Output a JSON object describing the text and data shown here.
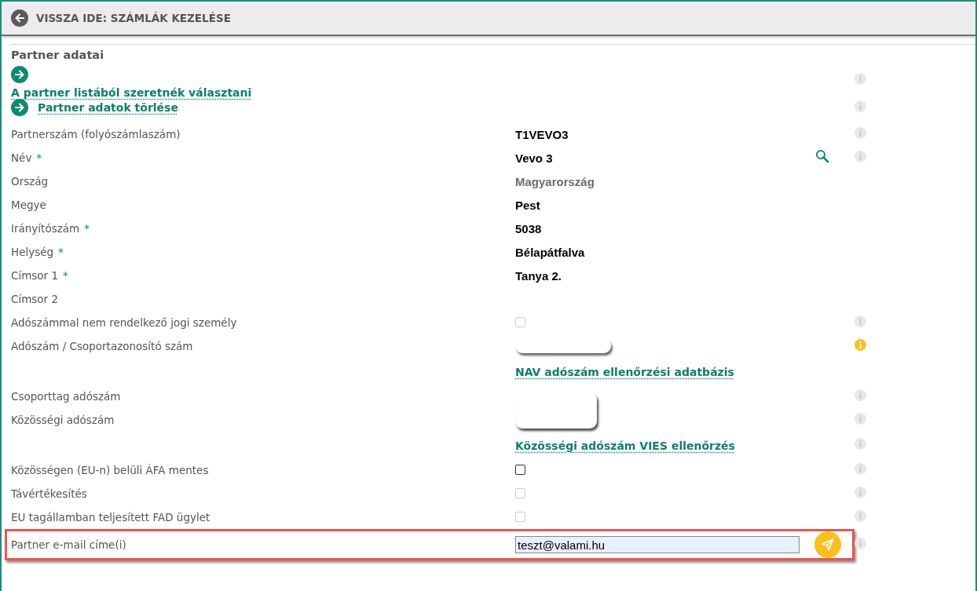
{
  "header": {
    "title": "VISSZA IDE: SZÁMLÁK KEZELÉSE"
  },
  "section": {
    "title": "Partner adatai"
  },
  "actions": [
    {
      "label": "A partner listából szeretnék választani",
      "stacked": true,
      "info": true
    },
    {
      "label": "Partner adatok törlése",
      "stacked": false,
      "info": true
    }
  ],
  "rows": [
    {
      "kind": "text",
      "label": "Partnerszám (folyószámlaszám)",
      "value": "T1VEVO3",
      "info": true
    },
    {
      "kind": "text",
      "label": "Név",
      "required_mark": "*",
      "value": "Vevo 3",
      "search": true,
      "info": true
    },
    {
      "kind": "muted",
      "label": "Ország",
      "value": "Magyarország"
    },
    {
      "kind": "text",
      "label": "Megye",
      "value": "Pest"
    },
    {
      "kind": "text",
      "label": "Irányítószám",
      "required_mark": "*",
      "value": "5038"
    },
    {
      "kind": "text",
      "label": "Helység",
      "required_mark": "*",
      "value": "Bélapátfalva"
    },
    {
      "kind": "text",
      "label": "Címsor 1",
      "required_mark": "*",
      "value": "Tanya 2."
    },
    {
      "kind": "text",
      "label": "Címsor 2"
    },
    {
      "kind": "checkbox",
      "label": "Adószámmal nem rendelkező jogi személy",
      "checked": false,
      "disabled": true,
      "info": true
    },
    {
      "kind": "pill",
      "label": "Adószám / Csoportazonosító szám",
      "warning": true
    },
    {
      "kind": "link",
      "link": "NAV adószám ellenőrzési adatbázis"
    },
    {
      "kind": "block",
      "label": "Csoporttag adószám",
      "info": true
    },
    {
      "kind": "text",
      "label": "Közösségi adószám",
      "info": true
    },
    {
      "kind": "link",
      "link": "Közösségi adószám VIES ellenőrzés",
      "info": true
    },
    {
      "kind": "checkbox",
      "label": "Közösségen (EU-n) belüli ÁFA mentes",
      "checked": false,
      "disabled": false,
      "info": true
    },
    {
      "kind": "checkbox",
      "label": "Távértékesítés",
      "checked": false,
      "disabled": true,
      "info": true
    },
    {
      "kind": "checkbox",
      "label": "EU tagállamban teljesített FAD ügylet",
      "checked": false,
      "disabled": true,
      "info": true
    },
    {
      "kind": "email",
      "label": "Partner e-mail címe(i)",
      "value": "teszt@valami.hu",
      "highlighted": true,
      "info": true
    }
  ]
}
